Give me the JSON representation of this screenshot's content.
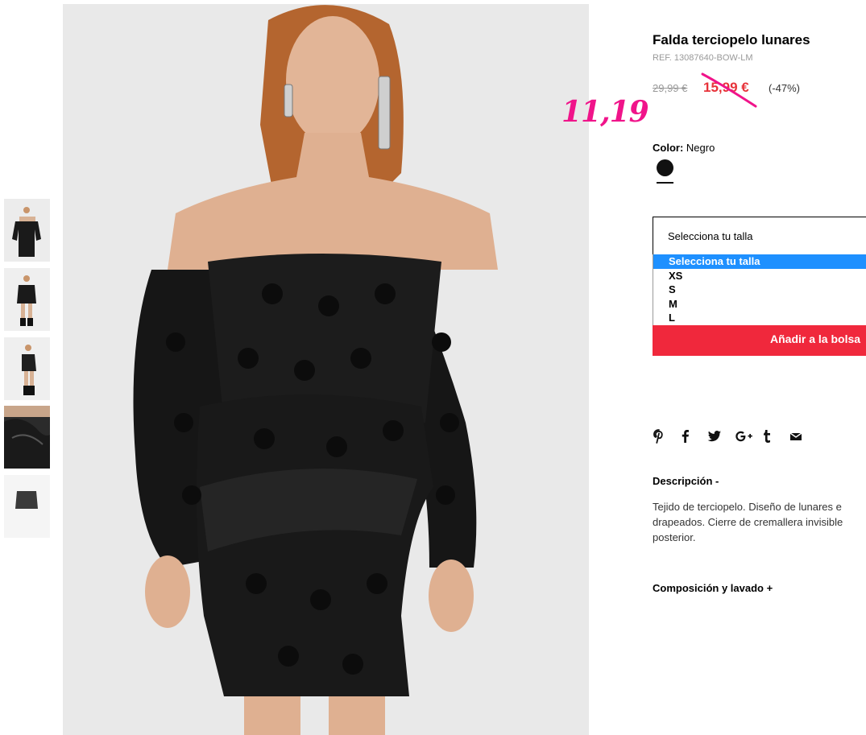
{
  "product": {
    "title": "Falda terciopelo lunares",
    "ref": "REF. 13087640-BOW-LM",
    "old_price": "29,99 €",
    "new_price": "15,99 €",
    "discount": "(-47%)",
    "handwritten_price": "11,19"
  },
  "color": {
    "label": "Color:",
    "value": "Negro",
    "swatch_hex": "#111111"
  },
  "size": {
    "select_label": "Selecciona tu talla",
    "options": [
      "Selecciona tu talla",
      "XS",
      "S",
      "M",
      "L"
    ],
    "highlighted_option_index": 0
  },
  "cart": {
    "add_label": "Añadir a la bolsa"
  },
  "share_icons": [
    "pinterest-icon",
    "facebook-icon",
    "twitter-icon",
    "google-plus-icon",
    "tumblr-icon",
    "email-icon"
  ],
  "description": {
    "heading": "Descripción -",
    "lines": [
      "Tejido de terciopelo. Diseño de lunares e",
      "drapeados. Cierre de cremallera invisible",
      "posterior."
    ]
  },
  "composition": {
    "heading": "Composición y lavado +"
  },
  "colors": {
    "accent": "#e7333a",
    "button": "#f0283c",
    "handwritten": "#f0148a",
    "dropdown_highlight": "#1e90ff"
  }
}
